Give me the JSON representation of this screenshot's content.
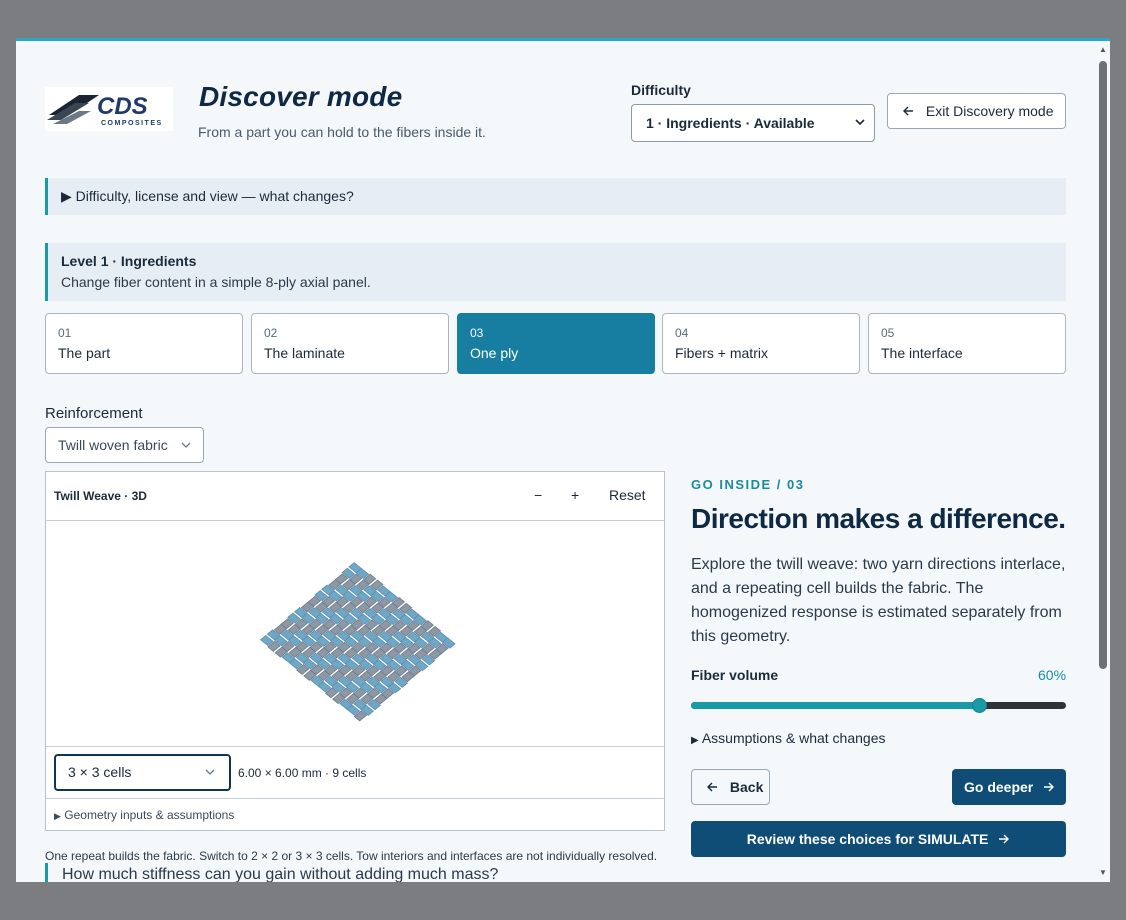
{
  "header": {
    "logo_text": "CDS",
    "logo_subtext": "COMPOSITES",
    "title": "Discover mode",
    "subtitle": "From a part you can hold to the fibers inside it.",
    "difficulty_label": "Difficulty",
    "difficulty_selected": "1 · Ingredients · Available",
    "exit_label": "Exit Discovery mode"
  },
  "details_summary": "Difficulty, license and view — what changes?",
  "level": {
    "title": "Level 1 · Ingredients",
    "description": "Change fiber content in a simple 8-ply axial panel."
  },
  "steps": [
    {
      "num": "01",
      "name": "The part",
      "active": false
    },
    {
      "num": "02",
      "name": "The laminate",
      "active": false
    },
    {
      "num": "03",
      "name": "One ply",
      "active": true
    },
    {
      "num": "04",
      "name": "Fibers + matrix",
      "active": false
    },
    {
      "num": "05",
      "name": "The interface",
      "active": false
    }
  ],
  "reinforcement": {
    "label": "Reinforcement",
    "selected": "Twill woven fabric"
  },
  "viewer": {
    "title": "Twill Weave · 3D",
    "zoom_out": "−",
    "zoom_in": "+",
    "reset": "Reset",
    "cells_selected": "3 × 3 cells",
    "cells_info": "6.00 × 6.00 mm · 9 cells",
    "geometry_summary": "Geometry inputs & assumptions",
    "colors": {
      "warp": "#6fa8c7",
      "weft": "#8c98a6"
    }
  },
  "note": "One repeat builds the fabric. Switch to 2 × 2 or 3 × 3 cells. Tow interiors and interfaces are not individually resolved.",
  "question": "How much stiffness can you gain without adding much mass?",
  "panel": {
    "kicker": "GO INSIDE / 03",
    "headline": "Direction makes a difference.",
    "body": "Explore the twill weave: two yarn directions interlace, and a repeating cell builds the fabric. The homogenized response is estimated separately from this geometry.",
    "fiber_volume_label": "Fiber volume",
    "fiber_volume_value": "60%",
    "fiber_volume_fraction": 0.77,
    "assumptions_summary": "Assumptions & what changes",
    "back_label": "Back",
    "deeper_label": "Go deeper",
    "review_label": "Review these choices for SIMULATE"
  },
  "colors": {
    "accent": "#1a9aa4",
    "primary": "#0f4d77",
    "active_step": "#177ea1",
    "title": "#0f2844"
  }
}
